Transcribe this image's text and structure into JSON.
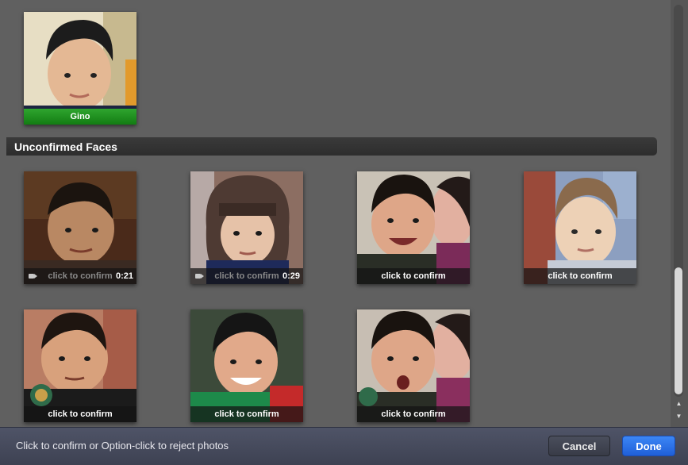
{
  "named_faces": [
    {
      "name": "Gino"
    }
  ],
  "unconfirmed_section": {
    "title": "Unconfirmed Faces"
  },
  "unconfirmed_faces": [
    {
      "caption": "click to confirm",
      "is_video": true,
      "duration": "0:21"
    },
    {
      "caption": "click to confirm",
      "is_video": true,
      "duration": "0:29"
    },
    {
      "caption": "click to confirm",
      "is_video": false
    },
    {
      "caption": "click to confirm",
      "is_video": false
    },
    {
      "caption": "click to confirm",
      "is_video": false
    },
    {
      "caption": "click to confirm",
      "is_video": false
    },
    {
      "caption": "click to confirm",
      "is_video": false
    }
  ],
  "bottom_bar": {
    "hint": "Click to confirm or Option-click to reject photos",
    "cancel_label": "Cancel",
    "done_label": "Done"
  },
  "colors": {
    "named_caption": "#1f8f1f",
    "done_button": "#2a6ee8",
    "background": "#606060"
  },
  "icons": [
    "video-camera-icon",
    "scroll-up-arrow-icon",
    "scroll-down-arrow-icon"
  ]
}
